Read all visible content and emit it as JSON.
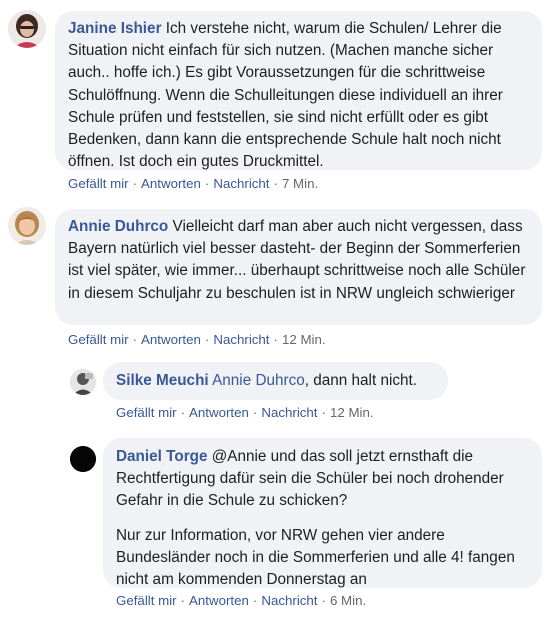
{
  "sep": "·",
  "comments": [
    {
      "author": "Janine Ishier",
      "text": "Ich verstehe nicht, warum die Schulen/ Lehrer die Situation nicht einfach für sich nutzen. (Machen manche sicher auch.. hoffe ich.) Es gibt Voraussetzungen für die schrittweise Schulöffnung. Wenn die Schulleitungen diese individuell an ihrer Schule prüfen und feststellen, sie sind nicht erfüllt oder es gibt Bedenken, dann kann die entsprechende Schule halt noch nicht öffnen. Ist doch ein gutes Druckmittel.",
      "like": "Gefällt mir",
      "reply": "Antworten",
      "message": "Nachricht",
      "time": "7 Min."
    },
    {
      "author": "Annie Duhrco",
      "text": "Vielleicht darf man aber auch nicht vergessen, dass Bayern natürlich viel besser dasteht- der Beginn der Sommerferien ist viel später, wie immer... überhaupt schrittweise noch alle Schüler in diesem Schuljahr zu beschulen ist in NRW ungleich schwieriger",
      "like": "Gefällt mir",
      "reply": "Antworten",
      "message": "Nachricht",
      "time": "12 Min."
    },
    {
      "author": "Silke Meuchi",
      "mention": "Annie Duhrco",
      "text": ", dann halt nicht.",
      "like": "Gefällt mir",
      "reply": "Antworten",
      "message": "Nachricht",
      "time": "12 Min."
    },
    {
      "author": "Daniel Torge",
      "text": "@Annie und das soll jetzt ernsthaft die Rechtfertigung dafür sein die Schüler bei noch drohender Gefahr in die Schule zu schicken?",
      "text2": "Nur zur Information, vor NRW gehen vier andere Bundesländer noch in die Sommerferien und alle 4! fangen nicht am kommenden Donnerstag an",
      "like": "Gefällt mir",
      "reply": "Antworten",
      "message": "Nachricht",
      "time": "6 Min."
    }
  ]
}
